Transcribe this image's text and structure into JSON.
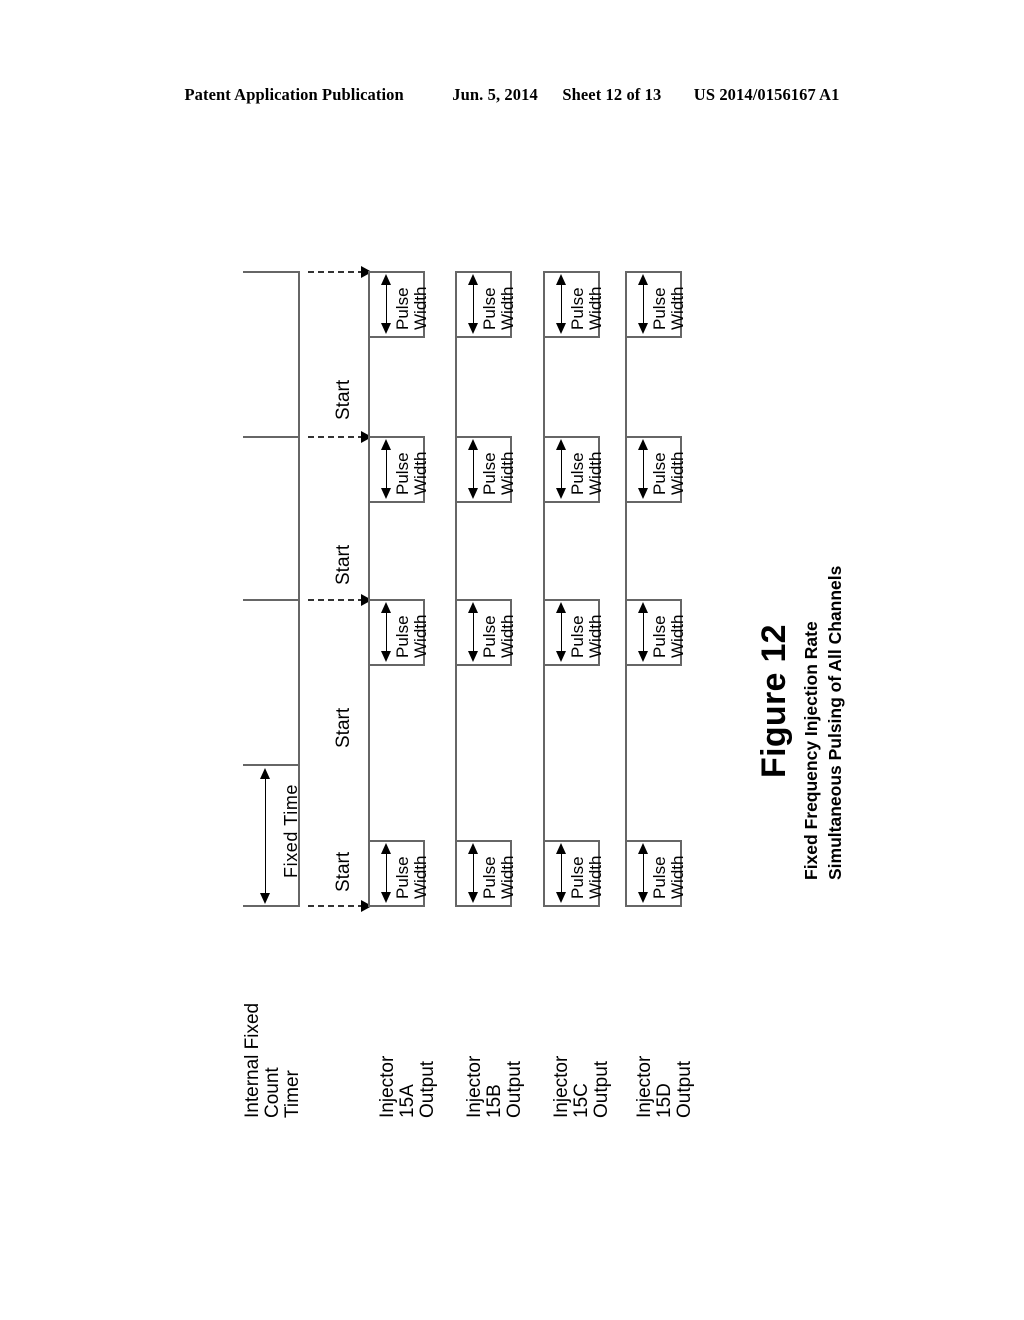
{
  "header": {
    "left": "Patent Application Publication",
    "date": "Jun. 5, 2014",
    "sheet": "Sheet 12 of 13",
    "patent_number": "US 2014/0156167 A1"
  },
  "figure": {
    "caption_title": "Figure 12",
    "caption_subtitle_line1": "Fixed Frequency Injection Rate",
    "caption_subtitle_line2": "Simultaneous Pulsing of All Channels",
    "fixed_time_label": "Fixed Time",
    "start_label": "Start",
    "pulse_width_line1": "Pulse",
    "pulse_width_line2": "Width",
    "rows": [
      {
        "id": "timer",
        "label_line1": "Internal Fixed",
        "label_line2": "Count",
        "label_line3": "Timer",
        "type": "timer",
        "tick_count": 4,
        "has_start_arrows": true
      },
      {
        "id": "injector-15a",
        "label_line1": "Injector",
        "label_line2": "15A",
        "label_line3": "Output",
        "type": "pulse-train",
        "pulse_count": 4,
        "has_start_arrows": false
      },
      {
        "id": "injector-15b",
        "label_line1": "Injector",
        "label_line2": "15B",
        "label_line3": "Output",
        "type": "pulse-train",
        "pulse_count": 4,
        "has_start_arrows": false
      },
      {
        "id": "injector-15c",
        "label_line1": "Injector",
        "label_line2": "15C",
        "label_line3": "Output",
        "type": "pulse-train",
        "pulse_count": 4,
        "has_start_arrows": false
      },
      {
        "id": "injector-15d",
        "label_line1": "Injector",
        "label_line2": "15D",
        "label_line3": "Output",
        "type": "pulse-train",
        "pulse_count": 4,
        "has_start_arrows": false
      }
    ],
    "chart_data": {
      "type": "line",
      "title": "Figure 12 — Fixed Frequency Injection Rate, Simultaneous Pulsing of All Channels",
      "orientation": "time axis runs bottom-to-top (drawing rotated 90 degrees CCW)",
      "xlabel": "",
      "ylabel": "",
      "grid": false,
      "legend": "none",
      "annotations": [
        "Fixed Time",
        "Start",
        "Pulse Width"
      ],
      "series": [
        {
          "name": "Internal Fixed Count Timer",
          "kind": "tick-marks",
          "tick_times": [
            0,
            1,
            2,
            3
          ],
          "period": 1,
          "note": "Fixed Time interval measured between consecutive timer edges"
        },
        {
          "name": "Injector 15A Output",
          "kind": "square-pulses",
          "pulse_starts": [
            0,
            1,
            2,
            3
          ],
          "pulse_widths": [
            0.38,
            0.38,
            0.38,
            0.38
          ],
          "triggered_by": "Start"
        },
        {
          "name": "Injector 15B Output",
          "kind": "square-pulses",
          "pulse_starts": [
            0,
            1,
            2,
            3
          ],
          "pulse_widths": [
            0.38,
            0.38,
            0.38,
            0.38
          ],
          "triggered_by": "Start"
        },
        {
          "name": "Injector 15C Output",
          "kind": "square-pulses",
          "pulse_starts": [
            0,
            1,
            2,
            3
          ],
          "pulse_widths": [
            0.38,
            0.38,
            0.38,
            0.38
          ],
          "triggered_by": "Start"
        },
        {
          "name": "Injector 15D Output",
          "kind": "square-pulses",
          "pulse_starts": [
            0,
            1,
            2,
            3
          ],
          "pulse_widths": [
            0.38,
            0.38,
            0.38,
            0.38
          ],
          "triggered_by": "Start"
        }
      ]
    }
  }
}
